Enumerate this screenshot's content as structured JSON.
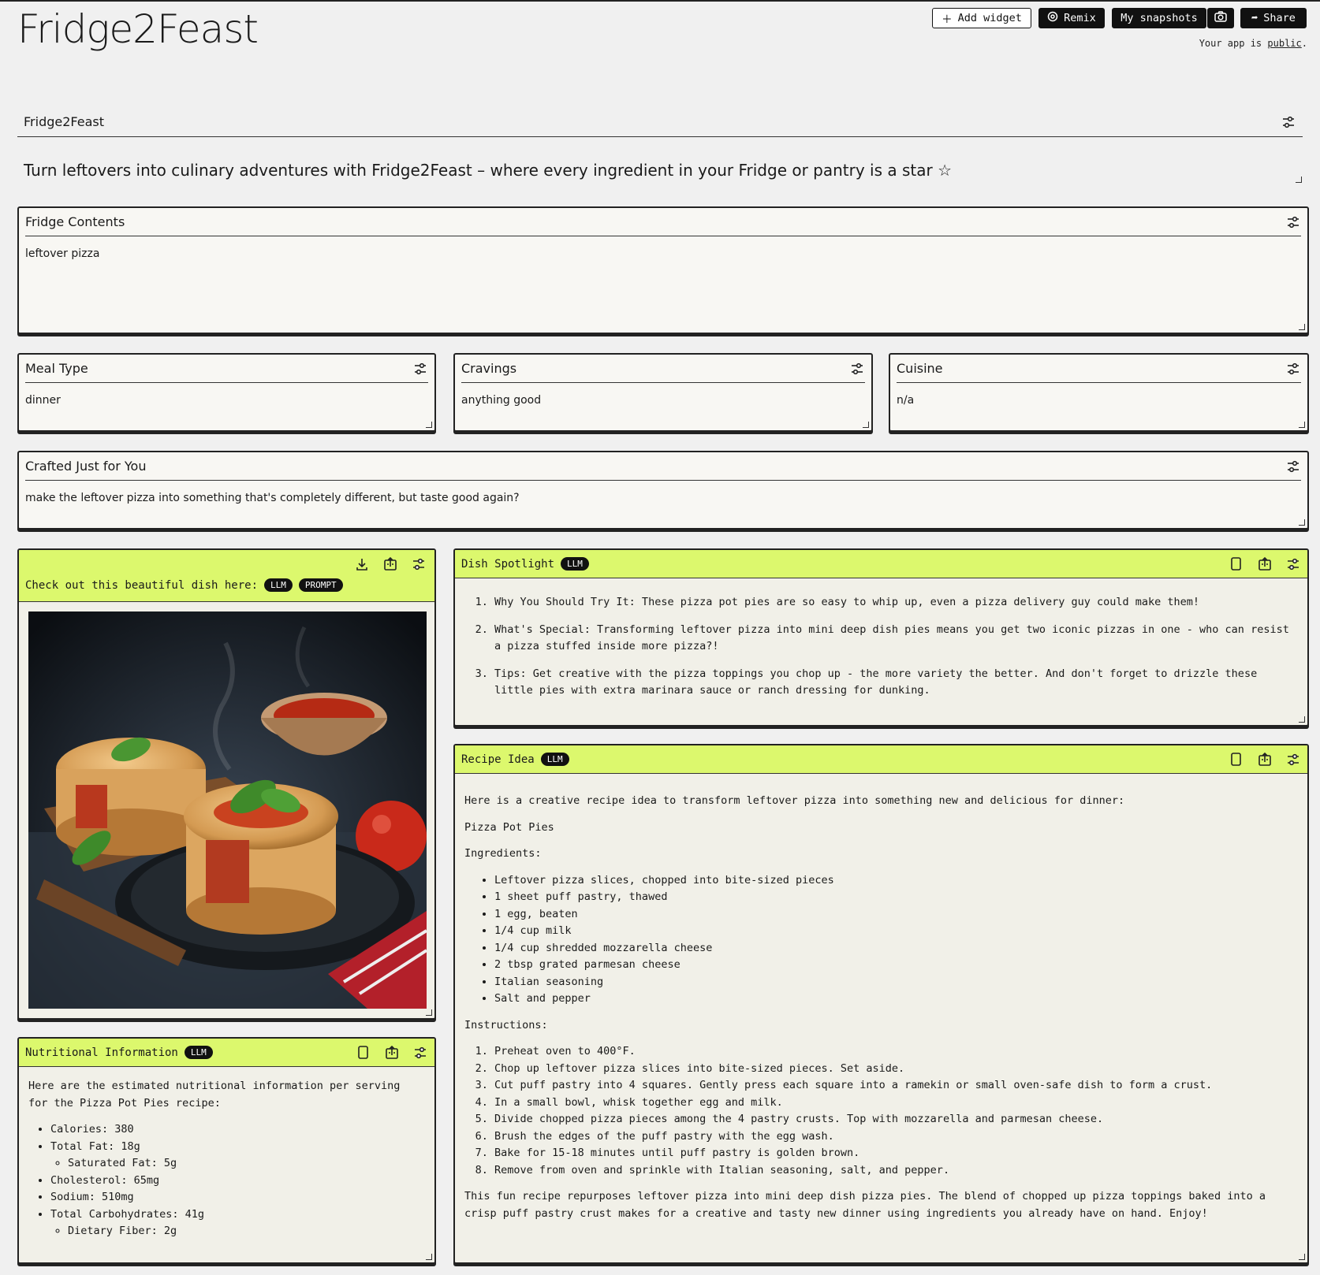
{
  "app": {
    "title": "Fridge2Feast"
  },
  "toolbar": {
    "add_widget": "Add widget",
    "remix": "Remix",
    "my_snapshots": "My snapshots",
    "share": "Share",
    "public_prefix": "Your app is",
    "public_link": "public",
    "public_suffix": "."
  },
  "header": {
    "title": "Fridge2Feast",
    "tagline": "Turn leftovers into culinary adventures with Fridge2Feast – where every ingredient in your Fridge or pantry is a star ☆"
  },
  "inputs": {
    "fridge": {
      "label": "Fridge Contents",
      "value": "leftover pizza"
    },
    "meal_type": {
      "label": "Meal Type",
      "value": "dinner"
    },
    "cravings": {
      "label": "Cravings",
      "value": "anything good"
    },
    "cuisine": {
      "label": "Cuisine",
      "value": "n/a"
    },
    "crafted": {
      "label": "Crafted Just for You",
      "value": "make the leftover pizza into something that's completely different, but taste good again?"
    }
  },
  "image_panel": {
    "title": "Check out this beautiful dish here:",
    "badges": [
      "LLM",
      "PROMPT"
    ]
  },
  "spotlight": {
    "title": "Dish Spotlight",
    "badge": "LLM",
    "items": [
      "Why You Should Try It: These pizza pot pies are so easy to whip up, even a pizza delivery guy could make them!",
      "What's Special: Transforming leftover pizza into mini deep dish pies means you get two iconic pizzas in one - who can resist a pizza stuffed inside more pizza?!",
      "Tips: Get creative with the pizza toppings you chop up - the more variety the better. And don't forget to drizzle these little pies with extra marinara sauce or ranch dressing for dunking."
    ]
  },
  "recipe": {
    "title": "Recipe Idea",
    "badge": "LLM",
    "intro": "Here is a creative recipe idea to transform leftover pizza into something new and delicious for dinner:",
    "name": "Pizza Pot Pies",
    "ingredients_label": "Ingredients:",
    "ingredients": [
      "Leftover pizza slices, chopped into bite-sized pieces",
      "1 sheet puff pastry, thawed",
      "1 egg, beaten",
      "1/4 cup milk",
      "1/4 cup shredded mozzarella cheese",
      "2 tbsp grated parmesan cheese",
      "Italian seasoning",
      "Salt and pepper"
    ],
    "instructions_label": "Instructions:",
    "instructions": [
      "Preheat oven to 400°F.",
      "Chop up leftover pizza slices into bite-sized pieces. Set aside.",
      "Cut puff pastry into 4 squares. Gently press each square into a ramekin or small oven-safe dish to form a crust.",
      "In a small bowl, whisk together egg and milk.",
      "Divide chopped pizza pieces among the 4 pastry crusts. Top with mozzarella and parmesan cheese.",
      "Brush the edges of the puff pastry with the egg wash.",
      "Bake for 15-18 minutes until puff pastry is golden brown.",
      "Remove from oven and sprinkle with Italian seasoning, salt, and pepper."
    ],
    "outro": "This fun recipe repurposes leftover pizza into mini deep dish pizza pies. The blend of chopped up pizza toppings baked into a crisp puff pastry crust makes for a creative and tasty new dinner using ingredients you already have on hand. Enjoy!"
  },
  "nutrition": {
    "title": "Nutritional Information",
    "badge": "LLM",
    "intro": "Here are the estimated nutritional information per serving for the Pizza Pot Pies recipe:",
    "calories": "Calories: 380",
    "total_fat": "Total Fat: 18g",
    "saturated_fat": "Saturated Fat: 5g",
    "cholesterol": "Cholesterol: 65mg",
    "sodium": "Sodium: 510mg",
    "carbs": "Total Carbohydrates: 41g",
    "fiber": "Dietary Fiber: 2g"
  }
}
